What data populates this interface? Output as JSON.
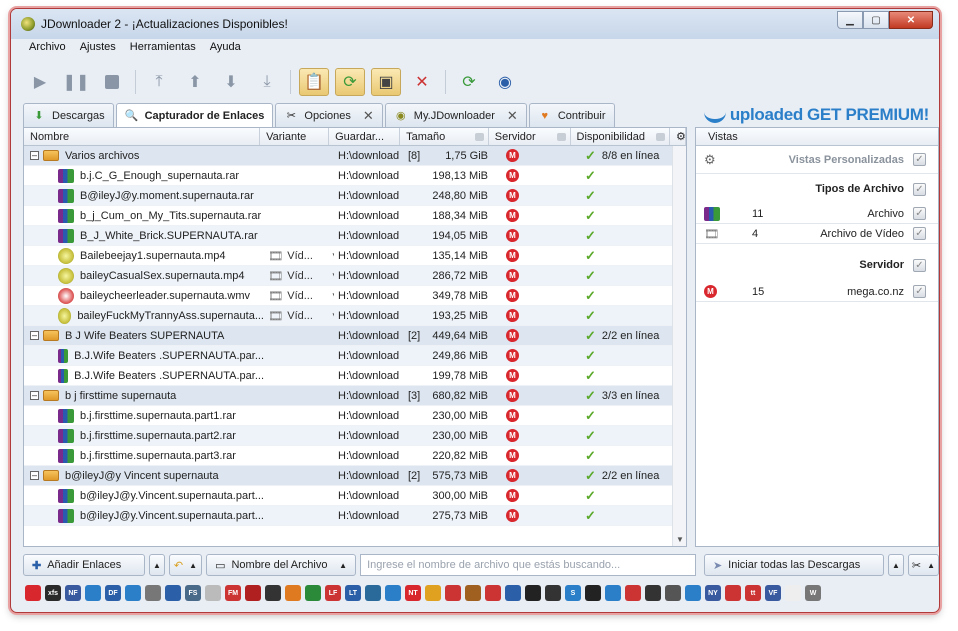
{
  "window": {
    "title": "JDownloader 2 - ¡Actualizaciones Disponibles!",
    "buttons": {
      "minimize": "▁",
      "maximize": "▢",
      "close": "✕"
    }
  },
  "menu": [
    "Archivo",
    "Ajustes",
    "Herramientas",
    "Ayuda"
  ],
  "toolbar": {
    "icons": [
      "play-icon",
      "pause-icon",
      "stop-icon",
      "move-top-icon",
      "move-up-icon",
      "move-down-icon",
      "move-bottom-icon",
      "clipboard-observer-icon",
      "auto-reconnect-icon",
      "premium-toggle-icon",
      "reconnect-disable-icon",
      "update-icon",
      "reconnect-icon"
    ]
  },
  "tabs": [
    {
      "label": "Descargas",
      "icon": "download-icon"
    },
    {
      "label": "Capturador de Enlaces",
      "icon": "linkgrabber-icon",
      "active": true
    },
    {
      "label": "Opciones",
      "icon": "tools-icon",
      "closable": true
    },
    {
      "label": "My.JDownloader",
      "icon": "myjd-icon",
      "closable": true
    },
    {
      "label": "Contribuir",
      "icon": "heart-icon"
    }
  ],
  "banner": {
    "brand": "uploaded",
    "cta": "GET PREMIUM!"
  },
  "grid": {
    "columns": [
      "Nombre",
      "Variante",
      "Guardar...",
      "Tamaño",
      "Servidor",
      "Disponibilidad"
    ],
    "rows": [
      {
        "type": "pkg",
        "name": "Varios archivos",
        "save": "H:\\download",
        "count": "[8]",
        "size": "1,75 GiB",
        "avail": "8/8 en línea"
      },
      {
        "type": "rar",
        "name": "b.j.C_G_Enough_supernauta.rar",
        "save": "H:\\download",
        "size": "198,13 MiB"
      },
      {
        "type": "rar",
        "name": "B@ileyJ@y.moment.supernauta.rar",
        "save": "H:\\download",
        "size": "248,80 MiB"
      },
      {
        "type": "rar",
        "name": "b_j_Cum_on_My_Tits.supernauta.rar",
        "save": "H:\\download",
        "size": "188,34 MiB"
      },
      {
        "type": "rar",
        "name": "B_J_White_Brick.SUPERNAUTA.rar",
        "save": "H:\\download",
        "size": "194,05 MiB"
      },
      {
        "type": "mp4",
        "name": "Bailebeejay1.supernauta.mp4",
        "variant": "Víd...",
        "save": "H:\\download",
        "size": "135,14 MiB"
      },
      {
        "type": "mp4",
        "name": "baileyCasualSex.supernauta.mp4",
        "variant": "Víd...",
        "save": "H:\\download",
        "size": "286,72 MiB"
      },
      {
        "type": "wmv",
        "name": "baileycheerleader.supernauta.wmv",
        "variant": "Víd...",
        "save": "H:\\download",
        "size": "349,78 MiB"
      },
      {
        "type": "mp4",
        "name": "baileyFuckMyTrannyAss.supernauta...",
        "variant": "Víd...",
        "save": "H:\\download",
        "size": "193,25 MiB"
      },
      {
        "type": "pkg",
        "name": "B J Wife Beaters SUPERNAUTA",
        "save": "H:\\download",
        "count": "[2]",
        "size": "449,64 MiB",
        "avail": "2/2 en línea"
      },
      {
        "type": "rar",
        "name": "B.J.Wife Beaters .SUPERNAUTA.par...",
        "save": "H:\\download",
        "size": "249,86 MiB"
      },
      {
        "type": "rar",
        "name": "B.J.Wife Beaters .SUPERNAUTA.par...",
        "save": "H:\\download",
        "size": "199,78 MiB"
      },
      {
        "type": "pkg",
        "name": "b j firsttime supernauta",
        "save": "H:\\download",
        "count": "[3]",
        "size": "680,82 MiB",
        "avail": "3/3 en línea"
      },
      {
        "type": "rar",
        "name": "b.j.firsttime.supernauta.part1.rar",
        "save": "H:\\download",
        "size": "230,00 MiB"
      },
      {
        "type": "rar",
        "name": "b.j.firsttime.supernauta.part2.rar",
        "save": "H:\\download",
        "size": "230,00 MiB"
      },
      {
        "type": "rar",
        "name": "b.j.firsttime.supernauta.part3.rar",
        "save": "H:\\download",
        "size": "220,82 MiB"
      },
      {
        "type": "pkg",
        "name": "b@ileyJ@y Vincent supernauta",
        "save": "H:\\download",
        "count": "[2]",
        "size": "575,73 MiB",
        "avail": "2/2 en línea"
      },
      {
        "type": "rar",
        "name": "b@ileyJ@y.Vincent.supernauta.part...",
        "save": "H:\\download",
        "size": "300,00 MiB"
      },
      {
        "type": "rar",
        "name": "b@ileyJ@y.Vincent.supernauta.part...",
        "save": "H:\\download",
        "size": "275,73 MiB"
      }
    ]
  },
  "side": {
    "header": "Vistas",
    "custom_views": "Vistas Personalizadas",
    "file_types_title": "Tipos de Archivo",
    "file_types": [
      {
        "count": "11",
        "label": "Archivo"
      },
      {
        "count": "4",
        "label": "Archivo de Vídeo"
      }
    ],
    "server_title": "Servidor",
    "servers": [
      {
        "count": "15",
        "label": "mega.co.nz"
      }
    ]
  },
  "bottom": {
    "add_links": "Añadir Enlaces",
    "filter_field": "Nombre del Archivo",
    "search_placeholder": "Ingrese el nombre de archivo que estás buscando...",
    "start_all": "Iniciar todas las Descargas"
  },
  "statusbar": {
    "icons": [
      "youtube",
      "xfs",
      "NF",
      "book",
      "DF",
      "file",
      "f",
      "chain",
      "FS",
      "search",
      "FM",
      "shield",
      "cat",
      "cloud",
      "hat",
      "LF",
      "LT",
      "circle",
      "drop",
      "NT",
      "coin",
      "bird",
      "box",
      "cross",
      "plane",
      "infinity",
      "play",
      "S",
      "eye",
      "down",
      "spiral",
      "slash",
      "c",
      "flask",
      "NY",
      "star",
      "tt",
      "VF",
      "blank",
      "W"
    ],
    "labels": {
      "xfs": "xfs",
      "NF": "NF",
      "DF": "DF",
      "FS": "FS",
      "FM": "FM",
      "LF": "LF",
      "LT": "LT",
      "NT": "NT",
      "S": "S",
      "NY": "NY",
      "tt": "tt",
      "VF": "VF",
      "W": "W"
    },
    "colors": {
      "youtube": "#d9272e",
      "mega": "#d9272e",
      "accent": "#2b7fc9"
    }
  }
}
